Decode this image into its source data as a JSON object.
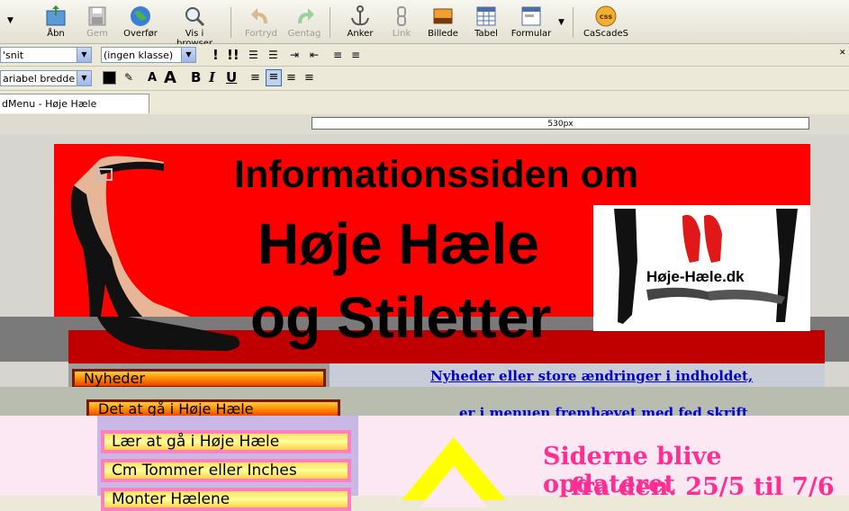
{
  "toolbar": {
    "buttons": [
      {
        "label": "Åbn",
        "icon": "open-icon"
      },
      {
        "label": "Gem",
        "icon": "save-icon"
      },
      {
        "label": "Overfør",
        "icon": "publish-icon"
      },
      {
        "label": "Vis i browser",
        "icon": "browse-icon"
      },
      {
        "label": "Fortryd",
        "icon": "undo-icon"
      },
      {
        "label": "Gentag",
        "icon": "redo-icon"
      },
      {
        "label": "Anker",
        "icon": "anchor-icon"
      },
      {
        "label": "Link",
        "icon": "link-icon"
      },
      {
        "label": "Billede",
        "icon": "image-icon"
      },
      {
        "label": "Tabel",
        "icon": "table-icon"
      },
      {
        "label": "Formular",
        "icon": "form-icon"
      },
      {
        "label": "CaScadeS",
        "icon": "css-icon"
      }
    ]
  },
  "format": {
    "paragraph_select": "'snit",
    "class_select": "(ingen klasse)",
    "font_select": "ariabel bredde",
    "bold": "B",
    "italic": "I",
    "underline": "U",
    "smaller": "A",
    "larger": "A"
  },
  "tab": {
    "label": "dMenu - Høje Hæle"
  },
  "ruler": {
    "width_label": "530px"
  },
  "page": {
    "banner_line1": "Informationssiden om",
    "banner_line2": "Høje Hæle",
    "banner_line3": "og Stiletter",
    "logo_text": "Høje-Hæle.dk",
    "news_link": "Nyheder eller store ændringer i indholdet,",
    "news_note": "er i menuen fremhævet med fed skrift",
    "menu_red": [
      "Nyheder",
      "Det at gå i Høje Hæle"
    ],
    "menu_pink": [
      "Lær at gå i Høje Hæle",
      "Cm Tommer eller Inches",
      "Monter Hælene"
    ],
    "update_line1": "Siderne blive opdateret",
    "update_line2": "fra den. 25/5 til 7/6"
  },
  "colors": {
    "banner": "#ff0000",
    "link": "#0000cc",
    "pink_text": "#ff2e93"
  }
}
